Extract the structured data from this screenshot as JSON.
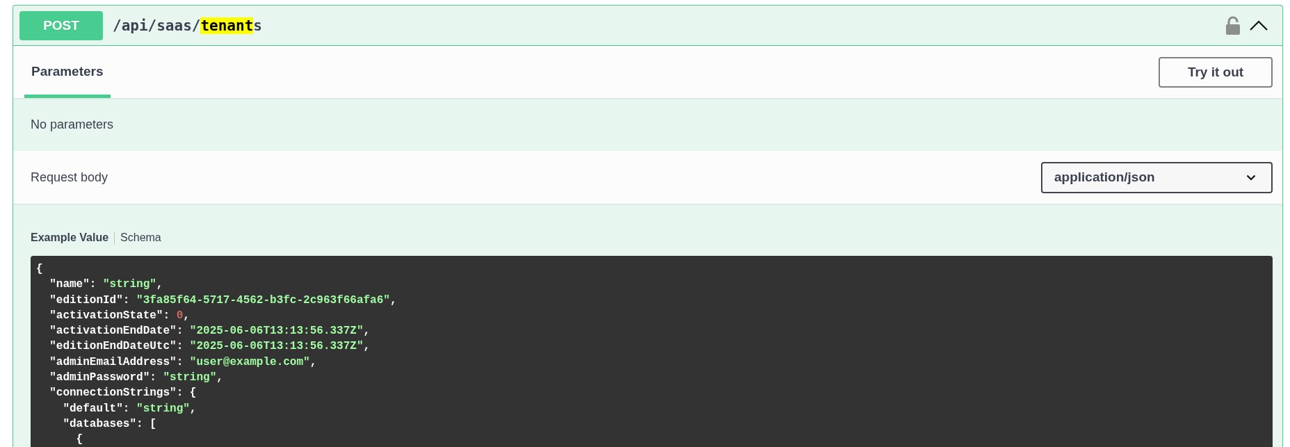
{
  "operation": {
    "method": "POST",
    "path": [
      {
        "text": "/api/saas/",
        "highlighted": false
      },
      {
        "text": "tenant",
        "highlighted": true
      },
      {
        "text": "s",
        "highlighted": false
      }
    ],
    "locked": false,
    "expanded": true
  },
  "tabs": [
    {
      "label": "Parameters",
      "selected": true
    }
  ],
  "try_button": "Try it out",
  "parameters_message": "No parameters",
  "request_body": {
    "label": "Request body",
    "content_type": "application/json"
  },
  "example_tabs": [
    {
      "label": "Example Value",
      "selected": true
    },
    {
      "label": "Schema",
      "selected": false
    }
  ],
  "code_lines": [
    [
      {
        "kind": "punct",
        "text": "{"
      }
    ],
    [
      {
        "kind": "key",
        "text": "  \"name\""
      },
      {
        "kind": "punct",
        "text": ": "
      },
      {
        "kind": "string",
        "text": "\"string\""
      },
      {
        "kind": "punct",
        "text": ","
      }
    ],
    [
      {
        "kind": "key",
        "text": "  \"editionId\""
      },
      {
        "kind": "punct",
        "text": ": "
      },
      {
        "kind": "string",
        "text": "\"3fa85f64-5717-4562-b3fc-2c963f66afa6\""
      },
      {
        "kind": "punct",
        "text": ","
      }
    ],
    [
      {
        "kind": "key",
        "text": "  \"activationState\""
      },
      {
        "kind": "punct",
        "text": ": "
      },
      {
        "kind": "number",
        "text": "0"
      },
      {
        "kind": "punct",
        "text": ","
      }
    ],
    [
      {
        "kind": "key",
        "text": "  \"activationEndDate\""
      },
      {
        "kind": "punct",
        "text": ": "
      },
      {
        "kind": "string",
        "text": "\"2025-06-06T13:13:56.337Z\""
      },
      {
        "kind": "punct",
        "text": ","
      }
    ],
    [
      {
        "kind": "key",
        "text": "  \"editionEndDateUtc\""
      },
      {
        "kind": "punct",
        "text": ": "
      },
      {
        "kind": "string",
        "text": "\"2025-06-06T13:13:56.337Z\""
      },
      {
        "kind": "punct",
        "text": ","
      }
    ],
    [
      {
        "kind": "key",
        "text": "  \"adminEmailAddress\""
      },
      {
        "kind": "punct",
        "text": ": "
      },
      {
        "kind": "string",
        "text": "\"user@example.com\""
      },
      {
        "kind": "punct",
        "text": ","
      }
    ],
    [
      {
        "kind": "key",
        "text": "  \"adminPassword\""
      },
      {
        "kind": "punct",
        "text": ": "
      },
      {
        "kind": "string",
        "text": "\"string\""
      },
      {
        "kind": "punct",
        "text": ","
      }
    ],
    [
      {
        "kind": "key",
        "text": "  \"connectionStrings\""
      },
      {
        "kind": "punct",
        "text": ": {"
      }
    ],
    [
      {
        "kind": "key",
        "text": "    \"default\""
      },
      {
        "kind": "punct",
        "text": ": "
      },
      {
        "kind": "string",
        "text": "\"string\""
      },
      {
        "kind": "punct",
        "text": ","
      }
    ],
    [
      {
        "kind": "key",
        "text": "    \"databases\""
      },
      {
        "kind": "punct",
        "text": ": ["
      }
    ],
    [
      {
        "kind": "punct",
        "text": "      {"
      }
    ]
  ]
}
